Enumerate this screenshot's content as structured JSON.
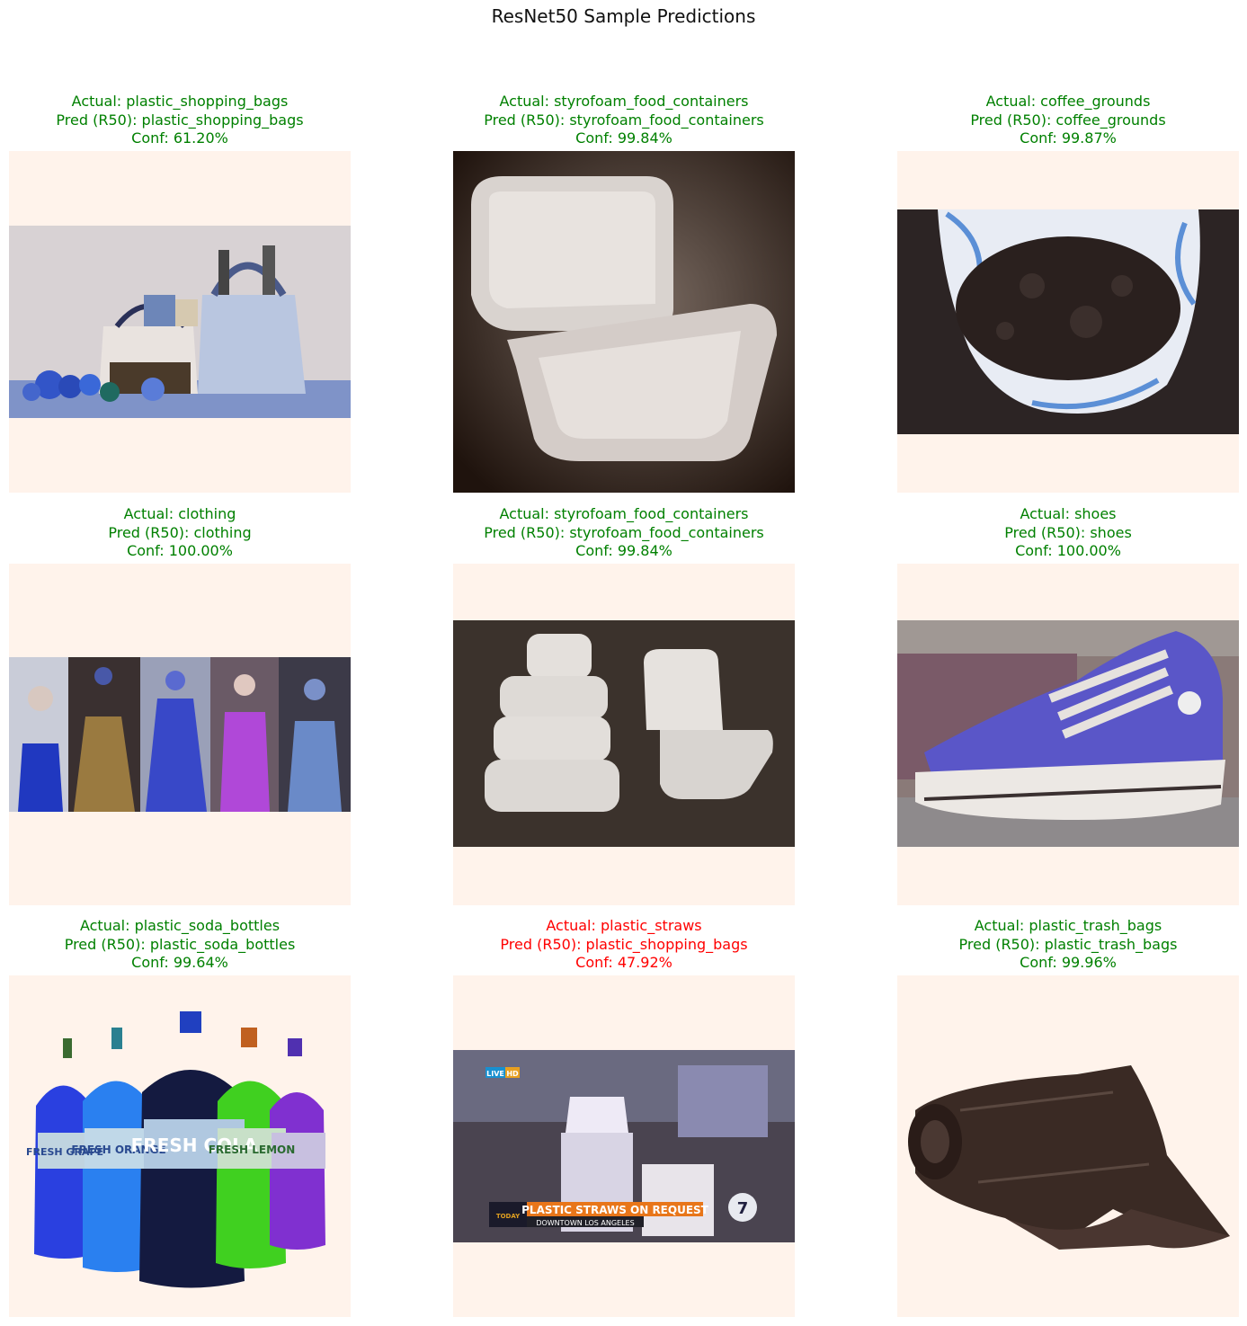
{
  "figure": {
    "title": "ResNet50 Sample Predictions"
  },
  "colors": {
    "correct": "#008000",
    "incorrect": "#ff0000",
    "padding": "#fff3eb"
  },
  "chart_data": {
    "type": "image-grid",
    "title": "ResNet50 Sample Predictions",
    "rows": 3,
    "cols": 3,
    "panels": [
      {
        "actual": "Actual: plastic_shopping_bags",
        "pred": "Pred (R50): plastic_shopping_bags",
        "conf": "Conf: 61.20%",
        "confidence": 61.2,
        "correct": true,
        "image": "reusable-shopping-bags-photo"
      },
      {
        "actual": "Actual: styrofoam_food_containers",
        "pred": "Pred (R50): styrofoam_food_containers",
        "conf": "Conf: 99.84%",
        "confidence": 99.84,
        "correct": true,
        "image": "open-foam-clamshell-photo"
      },
      {
        "actual": "Actual: coffee_grounds",
        "pred": "Pred (R50): coffee_grounds",
        "conf": "Conf: 99.87%",
        "confidence": 99.87,
        "correct": true,
        "image": "coffee-filter-grounds-photo"
      },
      {
        "actual": "Actual: clothing",
        "pred": "Pred (R50): clothing",
        "conf": "Conf: 100.00%",
        "confidence": 100.0,
        "correct": true,
        "image": "traditional-dresses-collage-photo"
      },
      {
        "actual": "Actual: styrofoam_food_containers",
        "pred": "Pred (R50): styrofoam_food_containers",
        "conf": "Conf: 99.84%",
        "confidence": 99.84,
        "correct": true,
        "image": "stacked-foam-containers-photo"
      },
      {
        "actual": "Actual: shoes",
        "pred": "Pred (R50): shoes",
        "conf": "Conf: 100.00%",
        "confidence": 100.0,
        "correct": true,
        "image": "giant-sneaker-photo"
      },
      {
        "actual": "Actual: plastic_soda_bottles",
        "pred": "Pred (R50): plastic_soda_bottles",
        "conf": "Conf: 99.64%",
        "confidence": 99.64,
        "correct": true,
        "image": "soda-bottles-photo"
      },
      {
        "actual": "Actual: plastic_straws",
        "pred": "Pred (R50): plastic_shopping_bags",
        "conf": "Conf: 47.92%",
        "confidence": 47.92,
        "correct": false,
        "image": "straws-news-broadcast-photo",
        "image_text": {
          "live": "LIVE",
          "hd": "HD",
          "banner": "PLASTIC STRAWS ON REQUEST",
          "location": "DOWNTOWN LOS ANGELES",
          "logo": "7",
          "eyewitness": "TODAY"
        }
      },
      {
        "actual": "Actual: plastic_trash_bags",
        "pred": "Pred (R50): plastic_trash_bags",
        "conf": "Conf: 99.96%",
        "confidence": 99.96,
        "correct": true,
        "image": "trash-bag-roll-photo"
      }
    ]
  },
  "bottle_labels": [
    "FRESH GRAPE",
    "FRESH ORANGE",
    "FRESH COLA",
    "FRESH LEMON",
    ""
  ]
}
